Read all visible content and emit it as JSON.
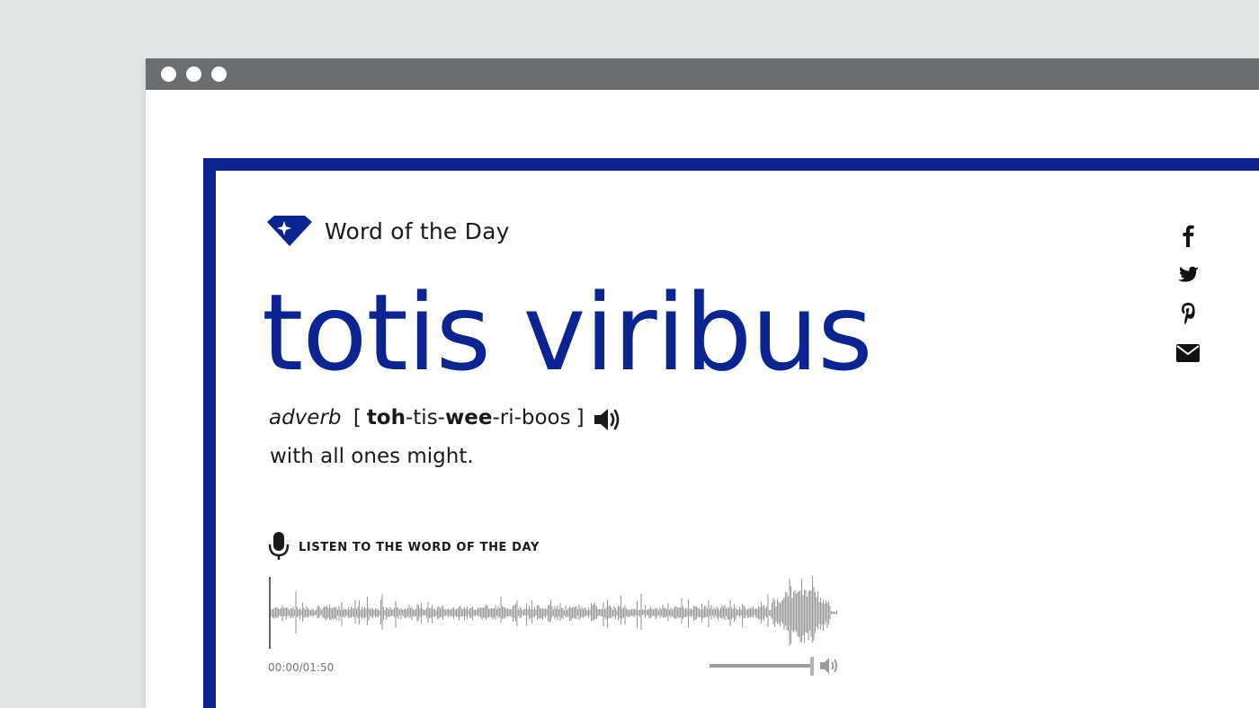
{
  "header": {
    "kicker": "Word of the Day"
  },
  "entry": {
    "word": "totis viribus",
    "part_of_speech": "adverb",
    "bracket_open": "[",
    "bracket_close": "]",
    "pronunciation": [
      {
        "text": "toh",
        "bold": true
      },
      {
        "text": "-tis-",
        "bold": false
      },
      {
        "text": "wee",
        "bold": true
      },
      {
        "text": "-ri-boos",
        "bold": false
      }
    ],
    "definition": "with all ones might."
  },
  "audio": {
    "label": "LISTEN TO THE WORD OF THE DAY",
    "time": "00:00/01:50",
    "volume_level": 1.0
  },
  "social": [
    "facebook-icon",
    "twitter-icon",
    "pinterest-icon",
    "email-icon"
  ],
  "colors": {
    "brand": "#0b2492",
    "titlebar": "#6b6e70",
    "waveform": "#9a9a9a",
    "background": "#e2e5e6"
  }
}
